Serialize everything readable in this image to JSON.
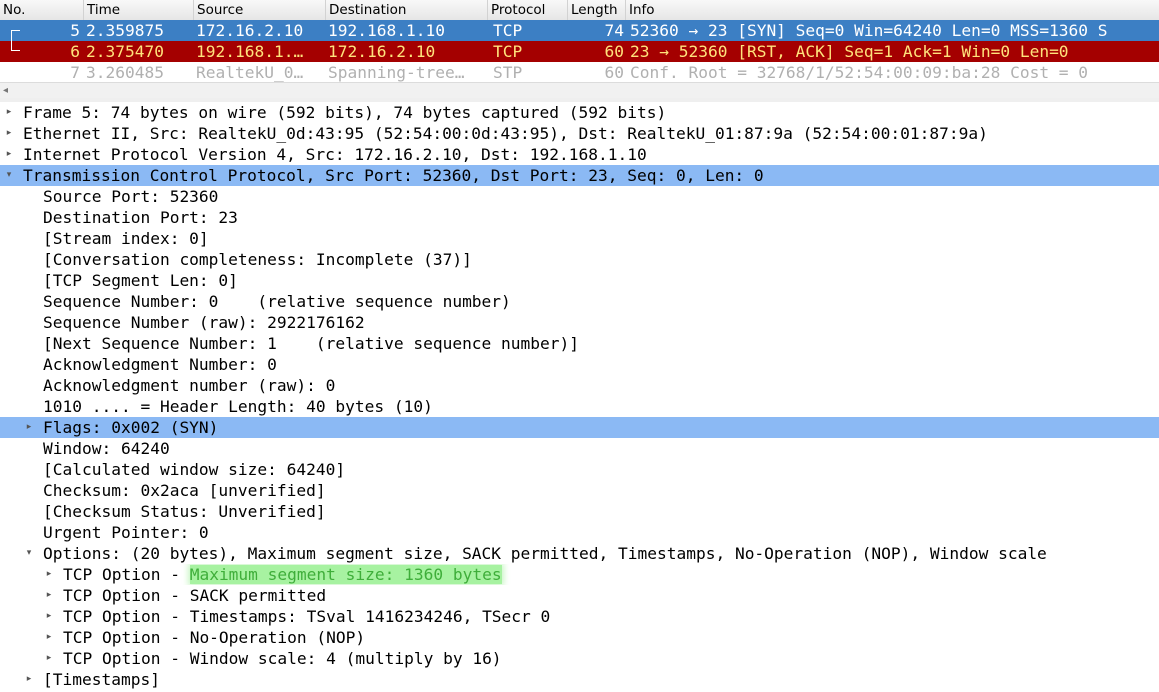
{
  "packet_list": {
    "columns": [
      "No.",
      "Time",
      "Source",
      "Destination",
      "Protocol",
      "Length",
      "Info"
    ],
    "rows": [
      {
        "no": "5",
        "time": "2.359875",
        "source": "172.16.2.10",
        "destination": "192.168.1.10",
        "protocol": "TCP",
        "length": "74",
        "info": "52360 → 23 [SYN] Seq=0 Win=64240 Len=0 MSS=1360 S"
      },
      {
        "no": "6",
        "time": "2.375470",
        "source": "192.168.1.…",
        "destination": "172.16.2.10",
        "protocol": "TCP",
        "length": "60",
        "info": "23 → 52360 [RST, ACK] Seq=1 Ack=1 Win=0 Len=0"
      },
      {
        "no": "7",
        "time": "3.260485",
        "source": "RealtekU_0…",
        "destination": "Spanning-tree…",
        "protocol": "STP",
        "length": "60",
        "info": "Conf. Root = 32768/1/52:54:00:09:ba:28  Cost = 0"
      }
    ],
    "scroll_left_glyph": "◂"
  },
  "detail_tree": {
    "rows": [
      {
        "indent": 0,
        "arrow": "▸",
        "text": "Frame 5: 74 bytes on wire (592 bits), 74 bytes captured (592 bits)"
      },
      {
        "indent": 0,
        "arrow": "▸",
        "text": "Ethernet II, Src: RealtekU_0d:43:95 (52:54:00:0d:43:95), Dst: RealtekU_01:87:9a (52:54:00:01:87:9a)"
      },
      {
        "indent": 0,
        "arrow": "▸",
        "text": "Internet Protocol Version 4, Src: 172.16.2.10, Dst: 192.168.1.10"
      },
      {
        "indent": 0,
        "arrow": "▾",
        "text": "Transmission Control Protocol, Src Port: 52360, Dst Port: 23, Seq: 0, Len: 0",
        "highlight": true
      },
      {
        "indent": 1,
        "arrow": "",
        "text": "Source Port: 52360"
      },
      {
        "indent": 1,
        "arrow": "",
        "text": "Destination Port: 23"
      },
      {
        "indent": 1,
        "arrow": "",
        "text": "[Stream index: 0]"
      },
      {
        "indent": 1,
        "arrow": "",
        "text": "[Conversation completeness: Incomplete (37)]"
      },
      {
        "indent": 1,
        "arrow": "",
        "text": "[TCP Segment Len: 0]"
      },
      {
        "indent": 1,
        "arrow": "",
        "text": "Sequence Number: 0    (relative sequence number)"
      },
      {
        "indent": 1,
        "arrow": "",
        "text": "Sequence Number (raw): 2922176162"
      },
      {
        "indent": 1,
        "arrow": "",
        "text": "[Next Sequence Number: 1    (relative sequence number)]"
      },
      {
        "indent": 1,
        "arrow": "",
        "text": "Acknowledgment Number: 0"
      },
      {
        "indent": 1,
        "arrow": "",
        "text": "Acknowledgment number (raw): 0"
      },
      {
        "indent": 1,
        "arrow": "",
        "text": "1010 .... = Header Length: 40 bytes (10)"
      },
      {
        "indent": 1,
        "arrow": "▸",
        "text": "Flags: 0x002 (SYN)",
        "highlight": true
      },
      {
        "indent": 1,
        "arrow": "",
        "text": "Window: 64240"
      },
      {
        "indent": 1,
        "arrow": "",
        "text": "[Calculated window size: 64240]"
      },
      {
        "indent": 1,
        "arrow": "",
        "text": "Checksum: 0x2aca [unverified]"
      },
      {
        "indent": 1,
        "arrow": "",
        "text": "[Checksum Status: Unverified]"
      },
      {
        "indent": 1,
        "arrow": "",
        "text": "Urgent Pointer: 0"
      },
      {
        "indent": 1,
        "arrow": "▾",
        "text": "Options: (20 bytes), Maximum segment size, SACK permitted, Timestamps, No-Operation (NOP), Window scale"
      },
      {
        "indent": 2,
        "arrow": "▸",
        "text": "TCP Option - ",
        "green": "Maximum segment size: 1360 bytes"
      },
      {
        "indent": 2,
        "arrow": "▸",
        "text": "TCP Option - SACK permitted"
      },
      {
        "indent": 2,
        "arrow": "▸",
        "text": "TCP Option - Timestamps: TSval 1416234246, TSecr 0"
      },
      {
        "indent": 2,
        "arrow": "▸",
        "text": "TCP Option - No-Operation (NOP)"
      },
      {
        "indent": 2,
        "arrow": "▸",
        "text": "TCP Option - Window scale: 4 (multiply by 16)"
      },
      {
        "indent": 1,
        "arrow": "▸",
        "text": "[Timestamps]"
      }
    ]
  },
  "colors": {
    "selected_row": "#3c7fc4",
    "rst_row": "#a40000",
    "rst_text": "#ffe37c",
    "tree_highlight": "#8bb9f4",
    "green_highlight": "#a7f2a1"
  }
}
